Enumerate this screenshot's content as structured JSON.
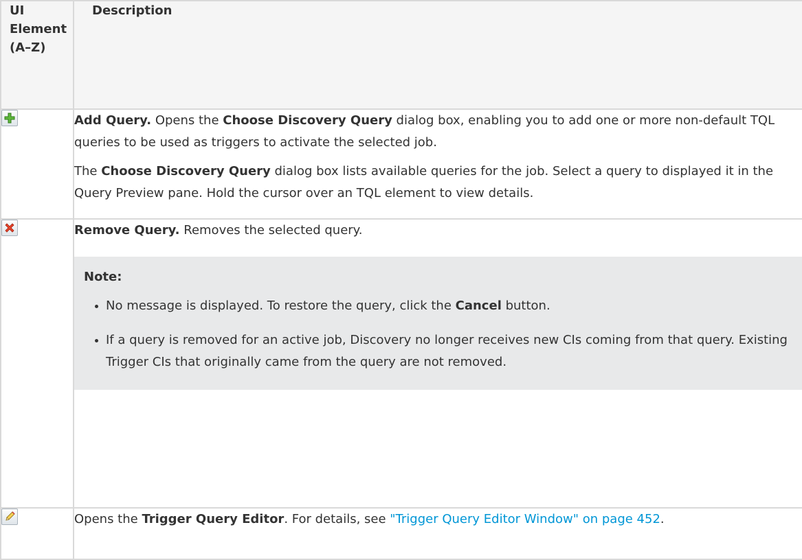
{
  "table": {
    "header": {
      "col1_line1": "UI",
      "col1_line2": "Element",
      "col1_line3": "(A–Z)",
      "col2": "Description"
    },
    "rows": [
      {
        "icon": "add-icon",
        "title": "Add Query.",
        "text1": " Opens the ",
        "bold1": "Choose Discovery Query",
        "text2": " dialog box, enabling you to add one or more non-default TQL queries to be used as triggers to activate the selected job.",
        "p2_text1": "The ",
        "p2_bold": "Choose Discovery Query",
        "p2_text2": " dialog box lists available queries for the job. Select a query to displayed it in the Query Preview pane. Hold the cursor over an TQL element to view details."
      },
      {
        "icon": "remove-icon",
        "title": "Remove Query.",
        "text1": " Removes the selected query.",
        "note_title": "Note:",
        "note_items": [
          {
            "before": "No message is displayed. To restore the query, click the ",
            "bold": "Cancel",
            "after": " button."
          },
          {
            "text": "If a query is removed for an active job, Discovery no longer receives new CIs coming from that query. Existing Trigger CIs that originally came from the query are not removed."
          }
        ]
      },
      {
        "icon": "edit-icon",
        "text1": "Opens the ",
        "bold1": "Trigger Query Editor",
        "text2": ". For details, see ",
        "link": "\"Trigger Query Editor Window\" on page 452",
        "text3": "."
      }
    ]
  },
  "colors": {
    "border": "#d9d9d9",
    "header_bg": "#f5f5f5",
    "note_bg": "#e8e9ea",
    "link": "#0096d6",
    "text": "#333333"
  }
}
